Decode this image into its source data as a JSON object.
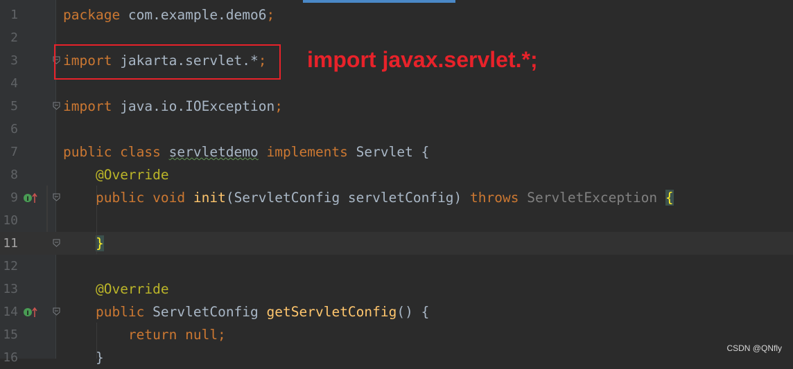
{
  "editor": {
    "lines": [
      {
        "n": "1",
        "tokens": [
          {
            "c": "kw",
            "t": "package "
          },
          {
            "c": "ty",
            "t": "com.example.demo6"
          },
          {
            "c": "kw",
            "t": ";"
          }
        ]
      },
      {
        "n": "2",
        "tokens": []
      },
      {
        "n": "3",
        "tokens": [
          {
            "c": "kw",
            "t": "import "
          },
          {
            "c": "ty",
            "t": "jakarta.servlet.*"
          },
          {
            "c": "kw",
            "t": ";"
          }
        ]
      },
      {
        "n": "4",
        "tokens": []
      },
      {
        "n": "5",
        "tokens": [
          {
            "c": "kw",
            "t": "import "
          },
          {
            "c": "ty",
            "t": "java.io.IOException"
          },
          {
            "c": "kw",
            "t": ";"
          }
        ]
      },
      {
        "n": "6",
        "tokens": []
      },
      {
        "n": "7",
        "tokens": [
          {
            "c": "kw",
            "t": "public class "
          },
          {
            "c": "ty typo",
            "t": "servletdemo"
          },
          {
            "c": "kw",
            "t": " implements "
          },
          {
            "c": "ty",
            "t": "Servlet {"
          }
        ]
      },
      {
        "n": "8",
        "tokens": [
          {
            "c": "ty",
            "t": "    "
          },
          {
            "c": "an",
            "t": "@Override"
          }
        ]
      },
      {
        "n": "9",
        "tokens": [
          {
            "c": "ty",
            "t": "    "
          },
          {
            "c": "kw",
            "t": "public void "
          },
          {
            "c": "fn",
            "t": "init"
          },
          {
            "c": "ty",
            "t": "(ServletConfig servletConfig) "
          },
          {
            "c": "kw",
            "t": "throws "
          },
          {
            "c": "gray",
            "t": "ServletException "
          },
          {
            "c": "brace-hl",
            "t": "{"
          }
        ]
      },
      {
        "n": "10",
        "tokens": []
      },
      {
        "n": "11",
        "tokens": [
          {
            "c": "ty",
            "t": "    "
          },
          {
            "c": "brace-hl",
            "t": "}"
          }
        ]
      },
      {
        "n": "12",
        "tokens": []
      },
      {
        "n": "13",
        "tokens": [
          {
            "c": "ty",
            "t": "    "
          },
          {
            "c": "an",
            "t": "@Override"
          }
        ]
      },
      {
        "n": "14",
        "tokens": [
          {
            "c": "ty",
            "t": "    "
          },
          {
            "c": "kw",
            "t": "public "
          },
          {
            "c": "ty",
            "t": "ServletConfig "
          },
          {
            "c": "fn",
            "t": "getServletConfig"
          },
          {
            "c": "ty",
            "t": "() {"
          }
        ]
      },
      {
        "n": "15",
        "tokens": [
          {
            "c": "ty",
            "t": "        "
          },
          {
            "c": "kw",
            "t": "return null;"
          }
        ]
      },
      {
        "n": "16",
        "tokens": [
          {
            "c": "ty",
            "t": "    }"
          }
        ]
      }
    ],
    "current_line": "11"
  },
  "annotation": {
    "text": "import javax.servlet.*;",
    "color": "#e8222a"
  },
  "gutter_icons": {
    "implements_icon": "implements-method-icon",
    "fold_icon": "fold-marker-icon"
  },
  "watermark": "CSDN @QNfly"
}
